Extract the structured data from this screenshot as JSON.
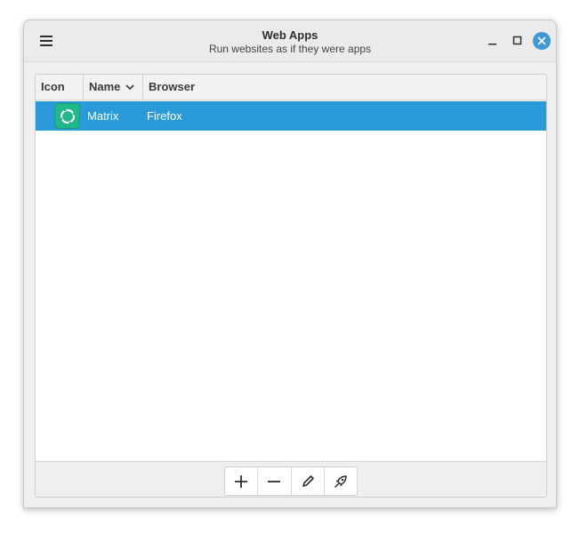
{
  "window": {
    "title": "Web Apps",
    "subtitle": "Run websites as if they were apps"
  },
  "titlebar_icons": {
    "menu": "hamburger-menu-icon",
    "minimize": "minimize-icon",
    "maximize": "maximize-icon",
    "close": "close-icon"
  },
  "table": {
    "columns": [
      "Icon",
      "Name",
      "Browser"
    ],
    "sort_column": "Name",
    "rows": [
      {
        "icon": "matrix-element-icon",
        "name": "Matrix",
        "browser": "Firefox",
        "selected": true
      }
    ]
  },
  "toolbar": {
    "buttons": [
      {
        "action": "add",
        "icon": "plus-icon"
      },
      {
        "action": "remove",
        "icon": "minus-icon"
      },
      {
        "action": "edit",
        "icon": "pencil-icon"
      },
      {
        "action": "launch",
        "icon": "rocket-icon"
      }
    ]
  },
  "colors": {
    "accent": "#2a9bd8",
    "close_button": "#3d9ad6",
    "app_icon_bg": "#1fb987"
  }
}
